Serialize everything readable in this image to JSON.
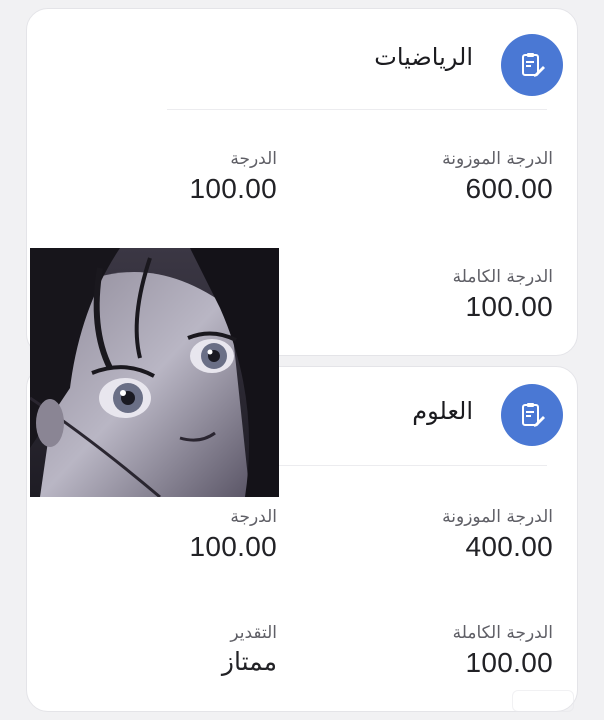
{
  "subjects": [
    {
      "name": "الرياضيات",
      "weighted_label": "الدرجة الموزونة",
      "weighted_value": "600.00",
      "grade_label": "الدرجة",
      "grade_value": "100.00",
      "full_label": "الدرجة الكاملة",
      "full_value": "100.00",
      "icon": "clipboard-edit-icon"
    },
    {
      "name": "العلوم",
      "weighted_label": "الدرجة الموزونة",
      "weighted_value": "400.00",
      "grade_label": "الدرجة",
      "grade_value": "100.00",
      "full_label": "الدرجة الكاملة",
      "full_value": "100.00",
      "rating_label": "التقدير",
      "rating_value": "ممتاز",
      "icon": "clipboard-edit-icon"
    }
  ],
  "colors": {
    "accent": "#4a78d4",
    "card": "#ffffff",
    "background": "#f1f1f3"
  },
  "overlay_image": "anime-character-portrait"
}
